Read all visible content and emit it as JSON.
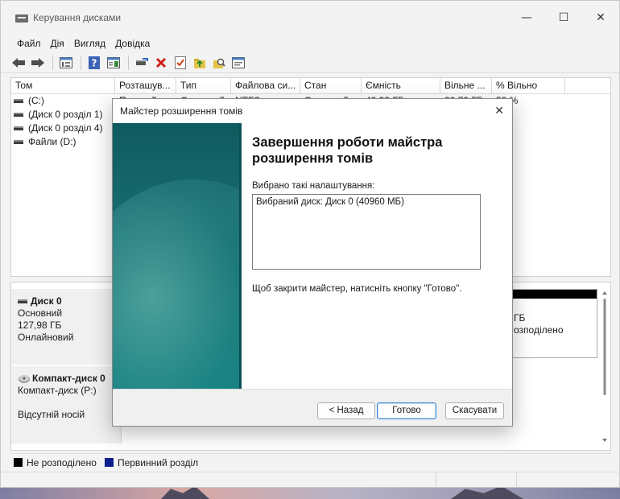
{
  "app": {
    "title": "Керування дисками",
    "icon": "disk-management-icon"
  },
  "menu": [
    "Файл",
    "Дія",
    "Вигляд",
    "Довідка"
  ],
  "toolbar": {
    "icons": [
      "back-arrow-icon",
      "forward-arrow-icon",
      "console-tree-icon",
      "help-icon",
      "properties-icon",
      "connect-disk-icon",
      "delete-icon",
      "check-icon",
      "folder-up-icon",
      "search-folder-icon",
      "settings-panel-icon"
    ]
  },
  "volume_list": {
    "columns": [
      "Том",
      "Розташув...",
      "Тип",
      "Файлова си...",
      "Стан",
      "Ємність",
      "Вільне ...",
      "% Вільно"
    ],
    "rows": [
      {
        "name": "(C:)",
        "layout": "Простий",
        "type": "Основний",
        "fs": "NTFS",
        "status": "Справний",
        "capacity": "48,33 ГБ",
        "free": "28,79 ГБ",
        "pct": "59 %"
      },
      {
        "name": "(Диск 0 розділ 1)",
        "layout": "",
        "type": "",
        "fs": "",
        "status": "",
        "capacity": "",
        "free": "",
        "pct": "%"
      },
      {
        "name": "(Диск 0 розділ 4)",
        "layout": "",
        "type": "",
        "fs": "",
        "status": "",
        "capacity": "",
        "free": "",
        "pct": "%"
      },
      {
        "name": "Файли (D:)",
        "layout": "",
        "type": "",
        "fs": "",
        "status": "",
        "capacity": "",
        "free": "",
        "pct": "%"
      }
    ]
  },
  "disks": {
    "disk0": {
      "title": "Диск 0",
      "type": "Основний",
      "size": "127,98 ГБ",
      "state": "Онлайновий"
    },
    "disk0_partition": {
      "line1": "ГБ",
      "line2": "озподілено"
    },
    "cdrom": {
      "title": "Компакт-диск 0",
      "type": "Компакт-диск (P:)",
      "state": "Відсутній носій"
    }
  },
  "legend": [
    {
      "label": "Не розподілено",
      "color": "#000000"
    },
    {
      "label": "Первинний розділ",
      "color": "#0a1e8c"
    }
  ],
  "dialog": {
    "title": "Майстер розширення томів",
    "heading": "Завершення роботи майстра розширення томів",
    "selected_label": "Вибрано такі налаштування:",
    "settings_text": "Вибраний диск: Диск 0 (40960 МБ)",
    "hint": "Щоб закрити майстер, натисніть кнопку \"Готово\".",
    "back_label": "< Назад",
    "finish_label": "Готово",
    "cancel_label": "Скасувати"
  }
}
